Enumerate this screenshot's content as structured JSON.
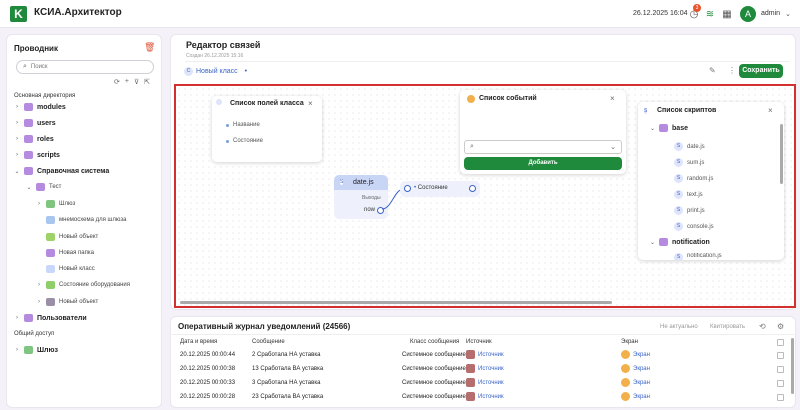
{
  "app": {
    "title": "КСИА.Архитектор",
    "logo_letter": "K",
    "datetime": "26.12.2025 16:04",
    "notifications_count": "3",
    "user": "admin",
    "avatar_letter": "A"
  },
  "sidebar": {
    "title": "Проводник",
    "search_placeholder": "Поиск",
    "main_dir_label": "Основная директория",
    "shared_label": "Общий доступ",
    "items": [
      {
        "label": "modules",
        "caret": "›",
        "color": "#b58be0"
      },
      {
        "label": "users",
        "caret": "›",
        "color": "#b58be0"
      },
      {
        "label": "roles",
        "caret": "›",
        "color": "#b58be0"
      },
      {
        "label": "scripts",
        "caret": "›",
        "color": "#b58be0"
      },
      {
        "label": "Справочная система",
        "caret": "⌄",
        "color": "#b58be0"
      },
      {
        "label": "Тест",
        "caret": "⌄",
        "color": "#b58be0"
      },
      {
        "label": "Шлюз",
        "caret": "›",
        "color": "#7fc47f"
      },
      {
        "label": "мнемосхема для шлюза",
        "caret": "",
        "color": "#a9c6ef"
      },
      {
        "label": "Новый объект",
        "caret": "",
        "color": "#9ed36a"
      },
      {
        "label": "Новая папка",
        "caret": "",
        "color": "#b58be0"
      },
      {
        "label": "Новый класс",
        "caret": "",
        "color": "#c9d7fb"
      },
      {
        "label": "Состояние оборудования",
        "caret": "›",
        "color": "#8fcf6a"
      },
      {
        "label": "Новый объект",
        "caret": "›",
        "color": "#9a8fa6"
      },
      {
        "label": "Пользователи",
        "caret": "›",
        "color": "#b58be0"
      },
      {
        "label": "Шлюз",
        "caret": "›",
        "color": "#7fc47f"
      }
    ]
  },
  "editor": {
    "title": "Редактор связей",
    "created": "Создан 26.12.2025 15:16",
    "class_label": "Новый класс",
    "save_label": "Сохранить"
  },
  "fields_card": {
    "title": "Список полей класса",
    "items": [
      "Название",
      "Состояние"
    ]
  },
  "events_card": {
    "title": "Список событий",
    "add_label": "Добавить"
  },
  "scripts_card": {
    "title": "Список скриптов",
    "folders": [
      {
        "name": "base",
        "items": [
          "date.js",
          "sum.js",
          "random.js",
          "text.js",
          "print.js",
          "console.js"
        ]
      },
      {
        "name": "notification",
        "items": [
          "notification.js"
        ]
      }
    ]
  },
  "node": {
    "title": "date.js",
    "outputs_label": "Выходы",
    "out_label": "now",
    "state_label": "Состояние"
  },
  "journal": {
    "title": "Оперативный журнал уведомлений (24566)",
    "not_actual": "Не актуально",
    "quit": "Квитировать",
    "columns": [
      "Дата и время",
      "Сообщение",
      "Класс сообщения",
      "Источник",
      "Экран"
    ],
    "rows": [
      {
        "time": "20.12.2025 00:00:44",
        "msg": "2 Сработала НА уставка",
        "cls": "Системное сообщение",
        "src": "Источник",
        "screen": "Экран"
      },
      {
        "time": "20.12.2025 00:00:38",
        "msg": "13 Сработала ВА уставка",
        "cls": "Системное сообщение",
        "src": "Источник",
        "screen": "Экран"
      },
      {
        "time": "20.12.2025 00:00:33",
        "msg": "3 Сработала НА уставка",
        "cls": "Системное сообщение",
        "src": "Источник",
        "screen": "Экран"
      },
      {
        "time": "20.12.2025 00:00:28",
        "msg": "23 Сработала ВА уставка",
        "cls": "Системное сообщение",
        "src": "Источник",
        "screen": "Экран"
      }
    ]
  }
}
